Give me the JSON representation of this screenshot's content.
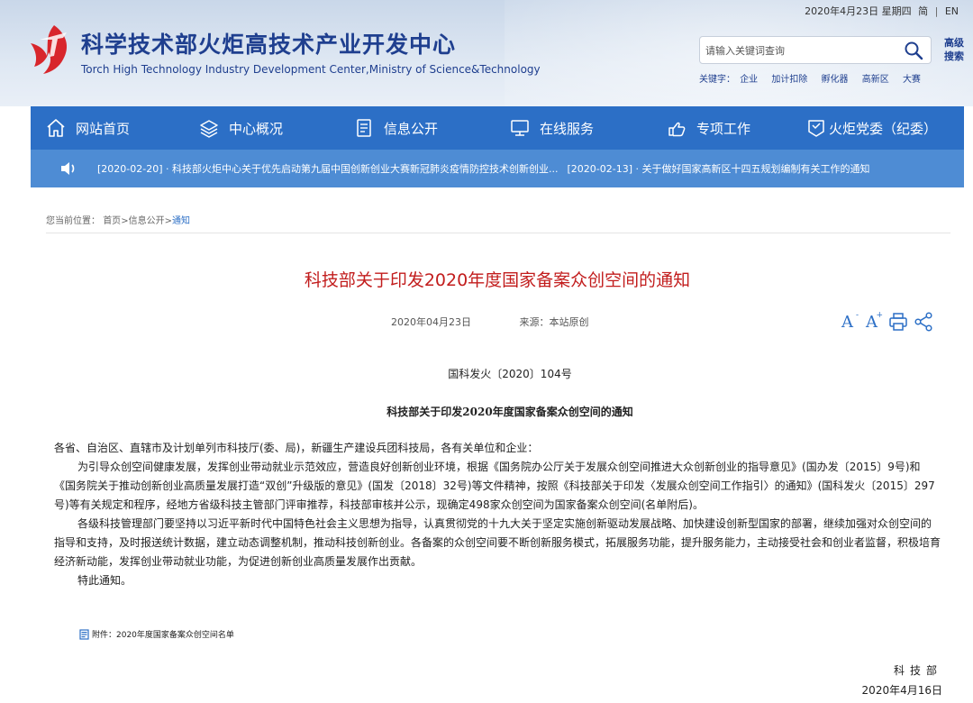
{
  "header": {
    "title": "科学技术部火炬高技术产业开发中心",
    "subtitle": "Torch High Technology Industry Development Center,Ministry of Science&Technology",
    "date": "2020年4月23日 星期四",
    "lang_cn": "简",
    "lang_en": "EN",
    "search_placeholder": "请输入关键词查询",
    "advanced_search": "高级搜索",
    "keywords_label": "关键字：",
    "keywords": [
      "企业",
      "加计扣除",
      "孵化器",
      "高新区",
      "大赛"
    ]
  },
  "nav": {
    "items": [
      {
        "label": "网站首页",
        "icon": "home-icon"
      },
      {
        "label": "中心概况",
        "icon": "layers-icon"
      },
      {
        "label": "信息公开",
        "icon": "document-icon"
      },
      {
        "label": "在线服务",
        "icon": "monitor-icon"
      },
      {
        "label": "专项工作",
        "icon": "hand-icon"
      },
      {
        "label": "火炬党委（纪委）",
        "icon": "badge-icon"
      }
    ]
  },
  "notice": {
    "items": [
      "[2020-02-20] · 科技部火炬中心关于优先启动第九届中国创新创业大赛新冠肺炎疫情防控技术创新创业...",
      "[2020-02-13] · 关于做好国家高新区十四五规划编制有关工作的通知"
    ]
  },
  "breadcrumb": {
    "label": "您当前位置：",
    "home": "首页",
    "sep": ">",
    "section": "信息公开",
    "current": "通知"
  },
  "article": {
    "title": "科技部关于印发2020年度国家备案众创空间的通知",
    "date": "2020年04月23日",
    "source": "来源：本站原创",
    "doc_no": "国科发火〔2020〕104号",
    "doc_title": "科技部关于印发2020年度国家备案众创空间的通知",
    "salutation": "各省、自治区、直辖市及计划单列市科技厅(委、局)，新疆生产建设兵团科技局，各有关单位和企业：",
    "para1": "为引导众创空间健康发展，发挥创业带动就业示范效应，营造良好创新创业环境，根据《国务院办公厅关于发展众创空间推进大众创新创业的指导意见》(国办发〔2015〕9号)和《国务院关于推动创新创业高质量发展打造“双创”升级版的意见》(国发〔2018〕32号)等文件精神，按照《科技部关于印发〈发展众创空间工作指引〉的通知》(国科发火〔2015〕297号)等有关规定和程序，经地方省级科技主管部门评审推荐，科技部审核并公示，现确定498家众创空间为国家备案众创空间(名单附后)。",
    "para2": "各级科技管理部门要坚持以习近平新时代中国特色社会主义思想为指导，认真贯彻党的十九大关于坚定实施创新驱动发展战略、加快建设创新型国家的部署，继续加强对众创空间的指导和支持，及时报送统计数据，建立动态调整机制，推动科技创新创业。各备案的众创空间要不断创新服务模式，拓展服务功能，提升服务能力，主动接受社会和创业者监督，积极培育经济新动能，发挥创业带动就业功能，为促进创新创业高质量发展作出贡献。",
    "closing": "特此通知。",
    "attachment": "附件：2020年度国家备案众创空间名单",
    "sign_org": "科技部",
    "sign_date": "2020年4月16日"
  },
  "colors": {
    "nav_bg": "#2c6fc6",
    "notice_bg": "#4e8cd4",
    "title_red": "#c21d1d",
    "brand_blue": "#1f3f8f"
  }
}
